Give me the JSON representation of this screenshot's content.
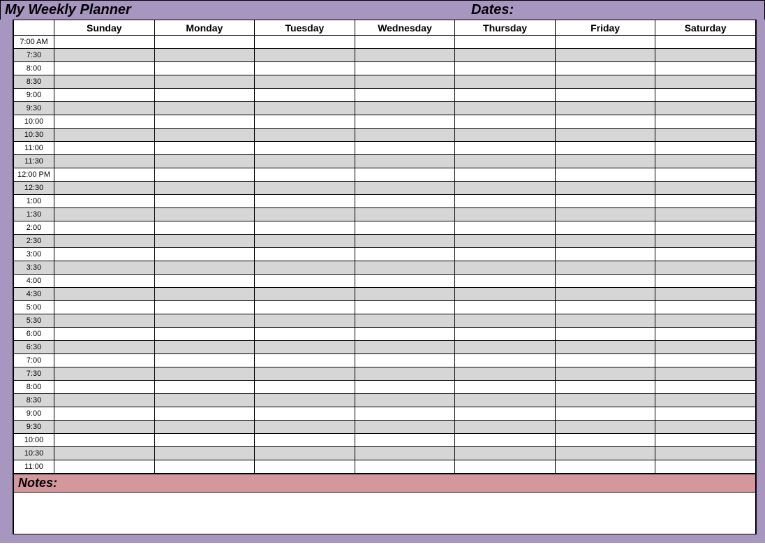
{
  "header": {
    "title": "My Weekly Planner",
    "dates_label": "Dates:"
  },
  "days": [
    "Sunday",
    "Monday",
    "Tuesday",
    "Wednesday",
    "Thursday",
    "Friday",
    "Saturday"
  ],
  "time_slots": [
    "7:00 AM",
    "7:30",
    "8:00",
    "8:30",
    "9:00",
    "9:30",
    "10:00",
    "10:30",
    "11:00",
    "11:30",
    "12:00 PM",
    "12:30",
    "1:00",
    "1:30",
    "2:00",
    "2:30",
    "3:00",
    "3:30",
    "4:00",
    "4:30",
    "5:00",
    "5:30",
    "6:00",
    "6:30",
    "7:00",
    "7:30",
    "8:00",
    "8:30",
    "9:00",
    "9:30",
    "10:00",
    "10:30",
    "11:00"
  ],
  "notes_label": "Notes:"
}
